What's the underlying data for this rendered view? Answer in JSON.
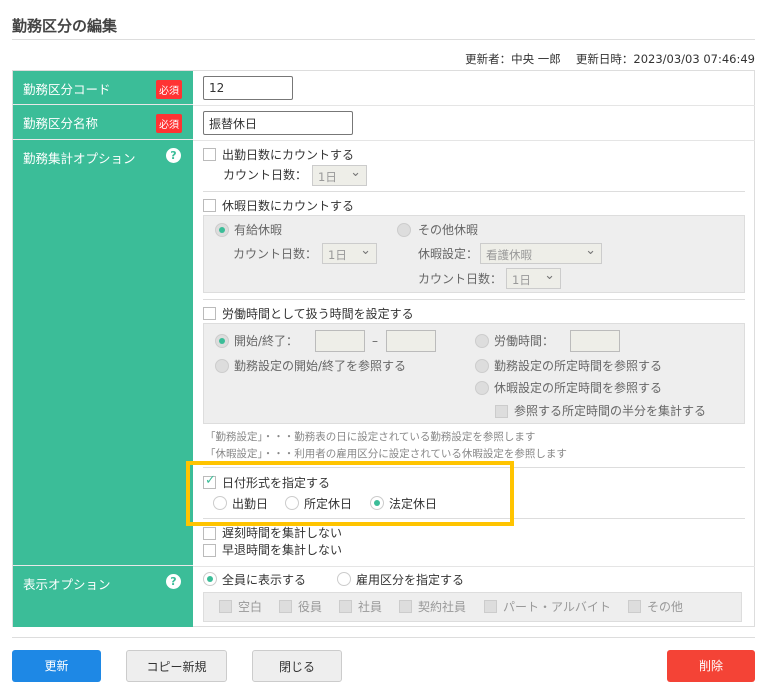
{
  "title": "勤務区分の編集",
  "meta": "更新者：中央 一郎　 更新日時：2023/03/03 07:46:49",
  "required": "必須",
  "rows": {
    "code": {
      "label": "勤務区分コード",
      "value": "12"
    },
    "name": {
      "label": "勤務区分名称",
      "value": "振替休日"
    },
    "agg": {
      "label": "勤務集計オプション",
      "count_work": "出勤日数にカウントする",
      "count_days": "カウント日数：",
      "days_val": "1日",
      "count_leave": "休暇日数にカウントする",
      "paid": "有給休暇",
      "other": "その他休暇",
      "leave_setting": "休暇設定：",
      "leave_val": "看護休暇",
      "work_time": "労働時間として扱う時間を設定する",
      "start_end": "開始/終了：",
      "dash": "–",
      "work_hours": "労働時間：",
      "ref_start_end": "勤務設定の開始/終了を参照する",
      "ref_work": "勤務設定の所定時間を参照する",
      "ref_leave": "休暇設定の所定時間を参照する",
      "half": "参照する所定時間の半分を集計する",
      "note1": "「勤務設定」・・・勤務表の日に設定されている勤務設定を参照します",
      "note2": "「休暇設定」・・・利用者の雇用区分に設定されている休暇設定を参照します",
      "date_format": "日付形式を指定する",
      "d1": "出勤日",
      "d2": "所定休日",
      "d3": "法定休日",
      "late": "遅刻時間を集計しない",
      "early": "早退時間を集計しない"
    },
    "display": {
      "label": "表示オプション",
      "all": "全員に表示する",
      "by_type": "雇用区分を指定する",
      "types": [
        "空白",
        "役員",
        "社員",
        "契約社員",
        "パート・アルバイト",
        "その他"
      ]
    }
  },
  "buttons": {
    "update": "更新",
    "copy": "コピー新規",
    "close": "閉じる",
    "delete": "削除"
  },
  "colors": {
    "accent": "#3bbd98",
    "primary": "#1e88e5",
    "danger": "#f44336",
    "highlight": "#ffc400"
  }
}
